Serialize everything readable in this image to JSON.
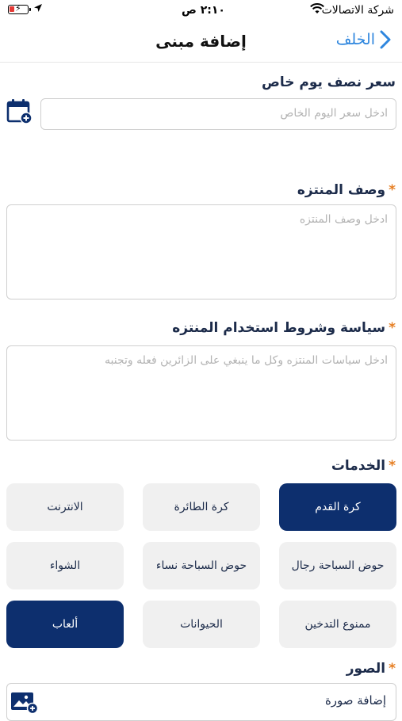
{
  "status_bar": {
    "carrier": "شركة الاتصالات",
    "time": "٢:١٠ ص"
  },
  "nav": {
    "title": "إضافة مبنى",
    "back_label": "الخلف"
  },
  "special_price": {
    "label": "سعر نصف يوم خاص",
    "placeholder": "ادخل سعر اليوم الخاص"
  },
  "description": {
    "label": "وصف المنتزه",
    "required_mark": "*",
    "placeholder": "ادخل وصف المنتزه"
  },
  "policy": {
    "label": "سياسة وشروط استخدام المنتزه",
    "required_mark": "*",
    "placeholder": "ادخل سياسات المنتزه وكل ما ينبغي على الزائرين فعله وتجنبه"
  },
  "services": {
    "label": "الخدمات",
    "required_mark": "*",
    "items": [
      {
        "label": "كرة القدم",
        "selected": true
      },
      {
        "label": "كرة الطائرة",
        "selected": false
      },
      {
        "label": "الانترنت",
        "selected": false
      },
      {
        "label": "حوض السباحة رجال",
        "selected": false
      },
      {
        "label": "حوض السباحة نساء",
        "selected": false
      },
      {
        "label": "الشواء",
        "selected": false
      },
      {
        "label": "ممنوع التدخين",
        "selected": false
      },
      {
        "label": "الحيوانات",
        "selected": false
      },
      {
        "label": "ألعاب",
        "selected": true
      }
    ]
  },
  "images": {
    "label": "الصور",
    "required_mark": "*",
    "add_label": "إضافة صورة"
  },
  "colors": {
    "accent": "#0d2f6e",
    "link": "#2e86de",
    "required": "#e67e22"
  }
}
